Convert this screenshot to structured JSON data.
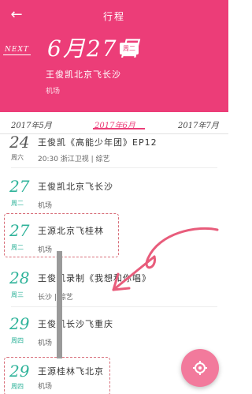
{
  "header": {
    "back_icon": "←",
    "title": "行程",
    "next_tag": "NEXT",
    "date": "6月27日",
    "weekday_badge": "周二",
    "event_title": "王俊凯北京飞长沙",
    "event_place": "机场"
  },
  "months": {
    "prev": "2017年5月",
    "current": "2017年6月",
    "next": "2017年7月"
  },
  "events": [
    {
      "day": "24",
      "weekday": "周六",
      "title": "王俊凯《高能少年团》EP12",
      "sub": "20:30  浙江卫视 | 综艺"
    },
    {
      "day": "27",
      "weekday": "周二",
      "title": "王俊凯北京飞长沙",
      "sub": "机场"
    },
    {
      "day": "27",
      "weekday": "周二",
      "title": "王源北京飞桂林",
      "sub": "机场"
    },
    {
      "day": "28",
      "weekday": "周三",
      "title": "王俊凯录制《我想和你唱》",
      "sub": "长沙 | 综艺"
    },
    {
      "day": "29",
      "weekday": "周四",
      "title": "王俊凯长沙飞重庆",
      "sub": "机场"
    },
    {
      "day": "29",
      "weekday": "周四",
      "title": "王源桂林飞北京",
      "sub": "机场"
    }
  ],
  "fab": {
    "icon": "location-icon"
  },
  "colors": {
    "accent": "#ec3d78",
    "teal": "#2fb39a",
    "fab": "#f27a9c"
  }
}
